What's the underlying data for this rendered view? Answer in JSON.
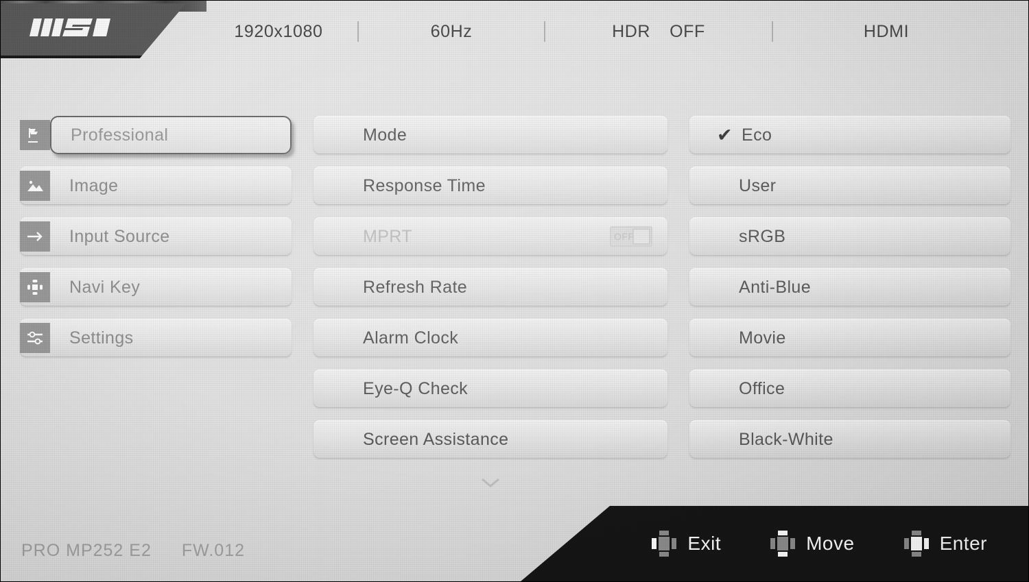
{
  "brand": {
    "logo_text": "MSI",
    "logo_icon": "msi-logo-icon"
  },
  "header": {
    "resolution": "1920x1080",
    "refresh_rate": "60Hz",
    "hdr_label": "HDR",
    "hdr_value": "OFF",
    "input": "HDMI"
  },
  "sidebar": {
    "items": [
      {
        "label": "Professional",
        "icon": "professional-flag-icon",
        "selected": true
      },
      {
        "label": "Image",
        "icon": "image-picture-icon",
        "selected": false
      },
      {
        "label": "Input Source",
        "icon": "arrow-right-icon",
        "selected": false
      },
      {
        "label": "Navi Key",
        "icon": "navi-key-dpad-icon",
        "selected": false
      },
      {
        "label": "Settings",
        "icon": "sliders-icon",
        "selected": false
      }
    ]
  },
  "middle_column": {
    "items": [
      {
        "label": "Mode",
        "dim": false,
        "toggle": null
      },
      {
        "label": "Response Time",
        "dim": false,
        "toggle": null
      },
      {
        "label": "MPRT",
        "dim": true,
        "toggle": "OFF"
      },
      {
        "label": "Refresh Rate",
        "dim": false,
        "toggle": null
      },
      {
        "label": "Alarm Clock",
        "dim": false,
        "toggle": null
      },
      {
        "label": "Eye-Q Check",
        "dim": false,
        "toggle": null
      },
      {
        "label": "Screen Assistance",
        "dim": false,
        "toggle": null
      }
    ],
    "more_indicator_icon": "chevron-down-icon"
  },
  "right_column": {
    "items": [
      {
        "label": "Eco",
        "checked": true
      },
      {
        "label": "User",
        "checked": false
      },
      {
        "label": "sRGB",
        "checked": false
      },
      {
        "label": "Anti-Blue",
        "checked": false
      },
      {
        "label": "Movie",
        "checked": false
      },
      {
        "label": "Office",
        "checked": false
      },
      {
        "label": "Black-White",
        "checked": false
      }
    ],
    "check_glyph": "✔"
  },
  "footer": {
    "model": "PRO  MP252  E2",
    "firmware": "FW.012",
    "nav": [
      {
        "label": "Exit",
        "icon": "joystick-left-icon",
        "active": [
          "l"
        ]
      },
      {
        "label": "Move",
        "icon": "joystick-updown-icon",
        "active": [
          "u",
          "d"
        ]
      },
      {
        "label": "Enter",
        "icon": "joystick-right-icon",
        "active": [
          "c",
          "r"
        ]
      }
    ]
  },
  "colors": {
    "background": "#e3e3e3",
    "text": "#5a5a5a",
    "dim_text": "#bdbdbd",
    "icon_tile": "#9a9a9a",
    "navbar": "#161616",
    "logo_banner": "#5c5c5c"
  }
}
